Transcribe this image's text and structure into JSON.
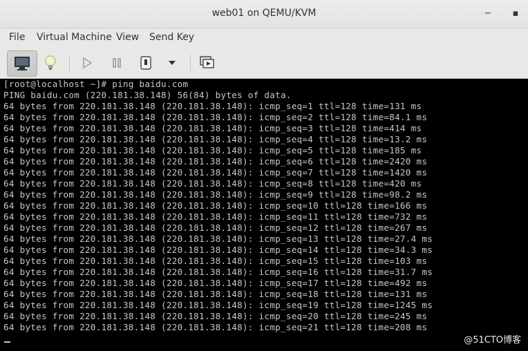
{
  "window": {
    "title": "web01 on QEMU/KVM",
    "minimize_glyph": "−",
    "maximize_glyph": "▪"
  },
  "menu": [
    "File",
    "Virtual Machine",
    "View",
    "Send Key"
  ],
  "toolbar": {
    "buttons": [
      {
        "icon": "console-icon",
        "active": true
      },
      {
        "icon": "lightbulb-icon",
        "active": false
      },
      {
        "icon": "play-icon",
        "active": false
      },
      {
        "icon": "pause-icon",
        "active": false
      },
      {
        "icon": "power-icon",
        "active": false
      },
      {
        "icon": "dropdown-arrow-icon",
        "active": false
      },
      {
        "icon": "snapshot-icon",
        "active": false
      }
    ]
  },
  "terminal": {
    "lines": [
      "[root@localhost ~]# ping baidu.com",
      "PING baidu.com (220.181.38.148) 56(84) bytes of data.",
      "64 bytes from 220.181.38.148 (220.181.38.148): icmp_seq=1 ttl=128 time=131 ms",
      "64 bytes from 220.181.38.148 (220.181.38.148): icmp_seq=2 ttl=128 time=84.1 ms",
      "64 bytes from 220.181.38.148 (220.181.38.148): icmp_seq=3 ttl=128 time=414 ms",
      "64 bytes from 220.181.38.148 (220.181.38.148): icmp_seq=4 ttl=128 time=13.2 ms",
      "64 bytes from 220.181.38.148 (220.181.38.148): icmp_seq=5 ttl=128 time=185 ms",
      "64 bytes from 220.181.38.148 (220.181.38.148): icmp_seq=6 ttl=128 time=2420 ms",
      "64 bytes from 220.181.38.148 (220.181.38.148): icmp_seq=7 ttl=128 time=1420 ms",
      "64 bytes from 220.181.38.148 (220.181.38.148): icmp_seq=8 ttl=128 time=420 ms",
      "64 bytes from 220.181.38.148 (220.181.38.148): icmp_seq=9 ttl=128 time=98.2 ms",
      "64 bytes from 220.181.38.148 (220.181.38.148): icmp_seq=10 ttl=128 time=166 ms",
      "64 bytes from 220.181.38.148 (220.181.38.148): icmp_seq=11 ttl=128 time=732 ms",
      "64 bytes from 220.181.38.148 (220.181.38.148): icmp_seq=12 ttl=128 time=267 ms",
      "64 bytes from 220.181.38.148 (220.181.38.148): icmp_seq=13 ttl=128 time=27.4 ms",
      "64 bytes from 220.181.38.148 (220.181.38.148): icmp_seq=14 ttl=128 time=34.3 ms",
      "64 bytes from 220.181.38.148 (220.181.38.148): icmp_seq=15 ttl=128 time=103 ms",
      "64 bytes from 220.181.38.148 (220.181.38.148): icmp_seq=16 ttl=128 time=31.7 ms",
      "64 bytes from 220.181.38.148 (220.181.38.148): icmp_seq=17 ttl=128 time=492 ms",
      "64 bytes from 220.181.38.148 (220.181.38.148): icmp_seq=18 ttl=128 time=131 ms",
      "64 bytes from 220.181.38.148 (220.181.38.148): icmp_seq=19 ttl=128 time=1245 ms",
      "64 bytes from 220.181.38.148 (220.181.38.148): icmp_seq=20 ttl=128 time=245 ms",
      "64 bytes from 220.181.38.148 (220.181.38.148): icmp_seq=21 ttl=128 time=208 ms"
    ]
  },
  "watermark": "@51CTO博客"
}
